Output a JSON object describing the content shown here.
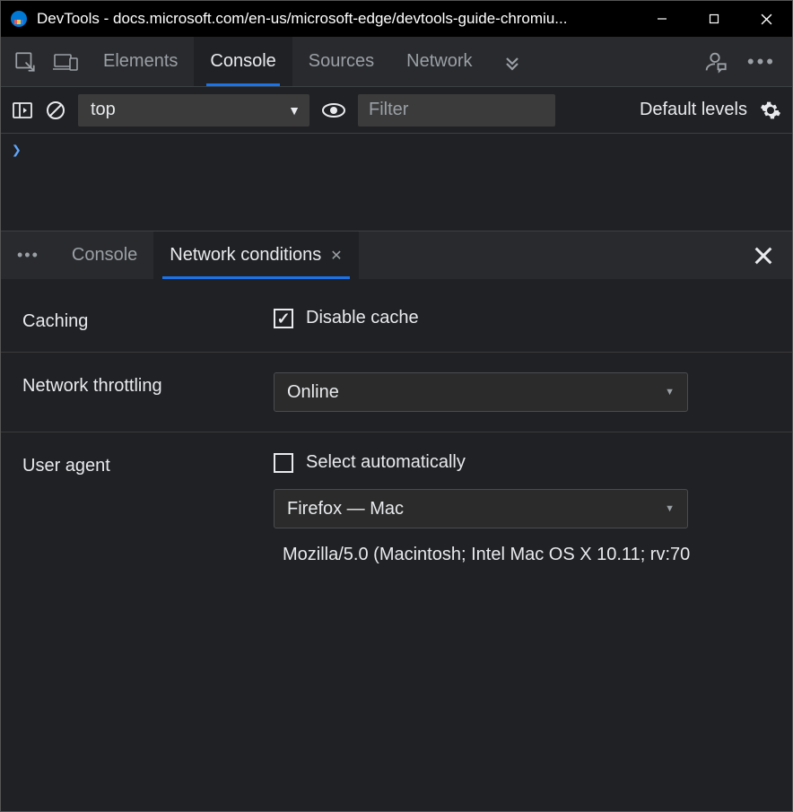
{
  "window": {
    "title": "DevTools - docs.microsoft.com/en-us/microsoft-edge/devtools-guide-chromiu..."
  },
  "main_tabs": {
    "items": [
      "Elements",
      "Console",
      "Sources",
      "Network"
    ],
    "active_index": 1
  },
  "console_toolbar": {
    "context": "top",
    "filter_placeholder": "Filter",
    "levels_label": "Default levels"
  },
  "console_prompt": "❯",
  "drawer_tabs": {
    "items": [
      "Console",
      "Network conditions"
    ],
    "active_index": 1
  },
  "network_conditions": {
    "caching": {
      "label": "Caching",
      "disable_cache_label": "Disable cache",
      "disable_cache_checked": true
    },
    "throttling": {
      "label": "Network throttling",
      "selected": "Online"
    },
    "user_agent": {
      "label": "User agent",
      "auto_label": "Select automatically",
      "auto_checked": false,
      "selected": "Firefox — Mac",
      "ua_string": "Mozilla/5.0 (Macintosh; Intel Mac OS X 10.11; rv:70"
    }
  }
}
